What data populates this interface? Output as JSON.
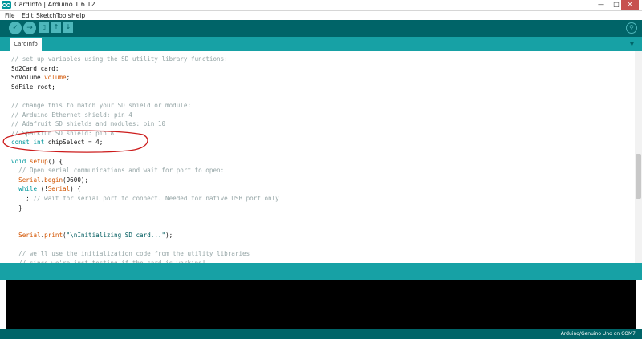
{
  "window": {
    "title": "CardInfo | Arduino 1.6.12",
    "minimize_glyph": "—",
    "maximize_glyph": "□",
    "close_glyph": "✕"
  },
  "menubar": {
    "items": [
      "File",
      "Edit",
      "Sketch",
      "Tools",
      "Help"
    ]
  },
  "toolbar": {
    "buttons": [
      {
        "name": "verify",
        "icon": "check-icon",
        "glyph": "✓"
      },
      {
        "name": "upload",
        "icon": "arrow-right-icon",
        "glyph": "→"
      },
      {
        "name": "new",
        "icon": "new-file-icon",
        "glyph": "▯"
      },
      {
        "name": "open",
        "icon": "open-arrow-up-icon",
        "glyph": "↑"
      },
      {
        "name": "save",
        "icon": "save-arrow-down-icon",
        "glyph": "↓"
      }
    ],
    "serial_monitor_icon": "magnifier-icon",
    "serial_monitor_glyph": "⚲"
  },
  "tabs": {
    "items": [
      "CardInfo"
    ],
    "menu_glyph": "▼"
  },
  "editor": {
    "lines": [
      [
        [
          "cm",
          "// set up variables using the SD utility library functions:"
        ]
      ],
      [
        [
          "pl",
          "Sd2Card card;"
        ]
      ],
      [
        [
          "pl",
          "SdVolume "
        ],
        [
          "fn",
          "volume"
        ],
        [
          "pl",
          ";"
        ]
      ],
      [
        [
          "pl",
          "SdFile root;"
        ]
      ],
      [
        [
          "pl",
          ""
        ]
      ],
      [
        [
          "cm",
          "// change this to match your SD shield or module;"
        ]
      ],
      [
        [
          "cm",
          "// Arduino Ethernet shield: pin 4"
        ]
      ],
      [
        [
          "cm",
          "// Adafruit SD shields and modules: pin 10"
        ]
      ],
      [
        [
          "cm",
          "// Sparkfun SD shield: pin 8"
        ]
      ],
      [
        [
          "kw",
          "const"
        ],
        [
          "pl",
          " "
        ],
        [
          "kw",
          "int"
        ],
        [
          "pl",
          " chipSelect = 4;"
        ]
      ],
      [
        [
          "pl",
          ""
        ]
      ],
      [
        [
          "kw",
          "void"
        ],
        [
          "pl",
          " "
        ],
        [
          "fn",
          "setup"
        ],
        [
          "pl",
          "() {"
        ]
      ],
      [
        [
          "cm",
          "  // Open serial communications and wait for port to open:"
        ]
      ],
      [
        [
          "pl",
          "  "
        ],
        [
          "fn",
          "Serial"
        ],
        [
          "pl",
          "."
        ],
        [
          "fn",
          "begin"
        ],
        [
          "pl",
          "(9600);"
        ]
      ],
      [
        [
          "pl",
          "  "
        ],
        [
          "kw",
          "while"
        ],
        [
          "pl",
          " (!"
        ],
        [
          "fn",
          "Serial"
        ],
        [
          "pl",
          ") {"
        ]
      ],
      [
        [
          "pl",
          "    ; "
        ],
        [
          "cm",
          "// wait for serial port to connect. Needed for native USB port only"
        ]
      ],
      [
        [
          "pl",
          "  }"
        ]
      ],
      [
        [
          "pl",
          ""
        ]
      ],
      [
        [
          "pl",
          ""
        ]
      ],
      [
        [
          "pl",
          "  "
        ],
        [
          "fn",
          "Serial"
        ],
        [
          "pl",
          "."
        ],
        [
          "fn",
          "print"
        ],
        [
          "pl",
          "("
        ],
        [
          "str",
          "\"\\nInitializing SD card...\""
        ],
        [
          "pl",
          ");"
        ]
      ],
      [
        [
          "pl",
          ""
        ]
      ],
      [
        [
          "cm",
          "  // we'll use the initialization code from the utility libraries"
        ]
      ],
      [
        [
          "cm",
          "  // since we're just testing if the card is working!"
        ]
      ]
    ]
  },
  "status": {
    "board_port": "Arduino/Genuino Uno on COM7"
  }
}
